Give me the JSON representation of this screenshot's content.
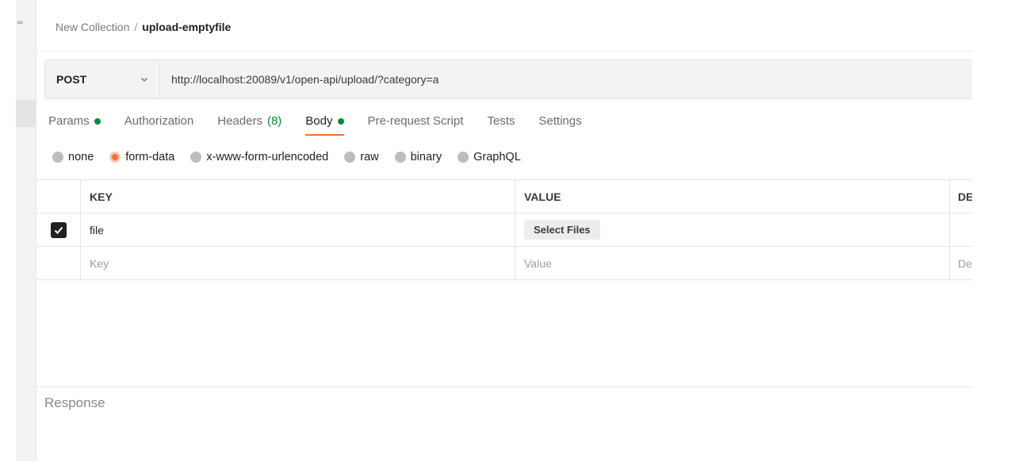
{
  "gutter": {
    "glyph": "ᵖᵒ"
  },
  "breadcrumb": {
    "collection": "New Collection",
    "separator": "/",
    "request": "upload-emptyfile"
  },
  "request": {
    "method": "POST",
    "url": "http://localhost:20089/v1/open-api/upload/?category=a"
  },
  "tabs": [
    {
      "label": "Params",
      "indicator": "dot"
    },
    {
      "label": "Authorization"
    },
    {
      "label": "Headers",
      "count": "(8)"
    },
    {
      "label": "Body",
      "indicator": "dot",
      "active": true
    },
    {
      "label": "Pre-request Script"
    },
    {
      "label": "Tests"
    },
    {
      "label": "Settings"
    }
  ],
  "body_types": {
    "options": [
      "none",
      "form-data",
      "x-www-form-urlencoded",
      "raw",
      "binary",
      "GraphQL"
    ],
    "selected": "form-data"
  },
  "table": {
    "headers": {
      "key": "KEY",
      "value": "VALUE",
      "description": "DE"
    },
    "rows": [
      {
        "checked": true,
        "key": "file",
        "value_button": "Select Files"
      }
    ],
    "placeholders": {
      "key": "Key",
      "value": "Value",
      "description": "De"
    }
  },
  "response": {
    "label": "Response"
  },
  "colors": {
    "accent": "#ff6c37",
    "indicator": "#0d8a3e",
    "text": "#212121"
  },
  "icons": {
    "method_dropdown": "chevron-down-icon",
    "checkbox": "check-icon"
  }
}
